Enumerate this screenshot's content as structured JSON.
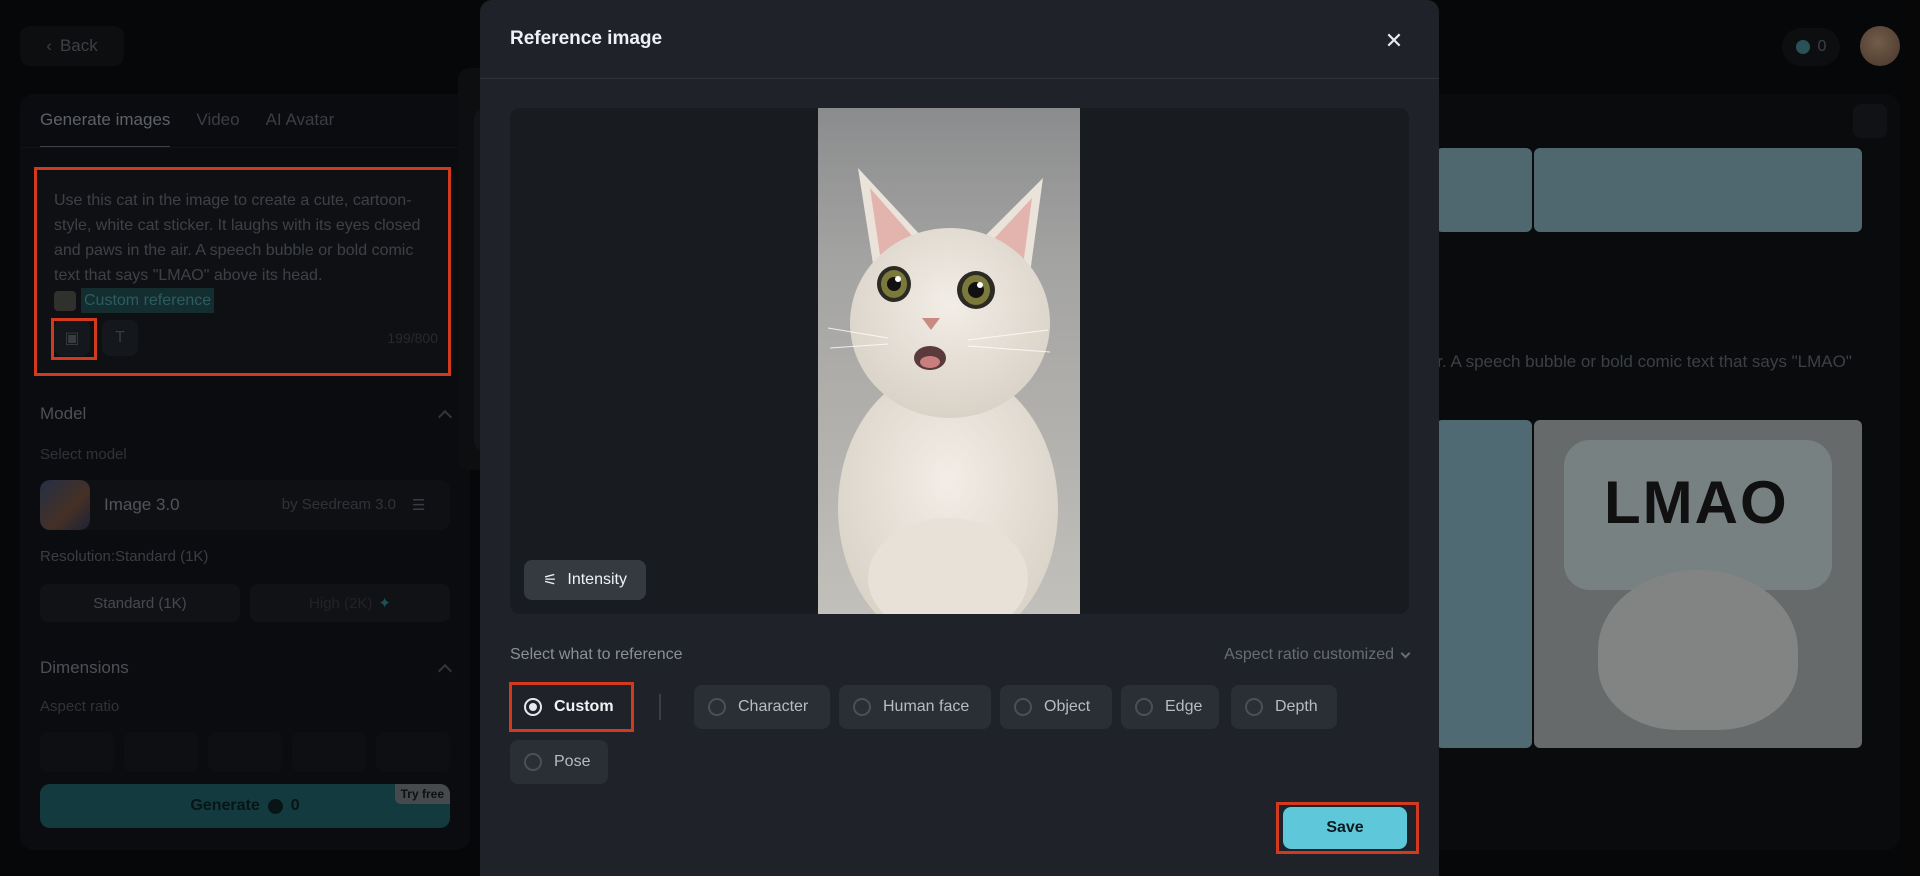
{
  "header": {
    "back_label": "Back",
    "credits": "0"
  },
  "left_panel": {
    "tabs": [
      {
        "label": "Generate images"
      },
      {
        "label": "Video"
      },
      {
        "label": "AI Avatar"
      }
    ],
    "prompt": {
      "text": "Use this cat in the image to create a cute, cartoon-style, white cat sticker. It laughs with its eyes closed and paws in the air. A speech bubble or bold comic text that says \"LMAO\" above its head.",
      "reference_tag": "Custom reference",
      "counter": "199/800"
    },
    "model": {
      "section_title": "Model",
      "select_label": "Select model",
      "name": "Image 3.0",
      "by": "by Seedream 3.0",
      "resolution_label": "Resolution:Standard (1K)",
      "standard_label": "Standard (1K)",
      "high_label": "High (2K)"
    },
    "dimensions": {
      "section_title": "Dimensions",
      "aspect_label": "Aspect ratio"
    },
    "generate": {
      "label": "Generate",
      "credits": "0",
      "badge": "Try free"
    }
  },
  "results": {
    "caption": "air. A speech bubble or bold comic text that says \"LMAO\"",
    "sticker_text": "LMAO"
  },
  "modal": {
    "title": "Reference image",
    "intensity_label": "Intensity",
    "select_label": "Select what to reference",
    "aspect_label": "Aspect ratio customized",
    "options": [
      {
        "label": "Custom",
        "selected": true
      },
      {
        "label": "Character",
        "selected": false
      },
      {
        "label": "Human face",
        "selected": false
      },
      {
        "label": "Object",
        "selected": false
      },
      {
        "label": "Edge",
        "selected": false
      },
      {
        "label": "Depth",
        "selected": false
      },
      {
        "label": "Pose",
        "selected": false
      }
    ],
    "save_label": "Save"
  },
  "colors": {
    "accent": "#5ec7d9",
    "highlight_box": "#d13a1f",
    "modal_bg": "#1f2329"
  }
}
